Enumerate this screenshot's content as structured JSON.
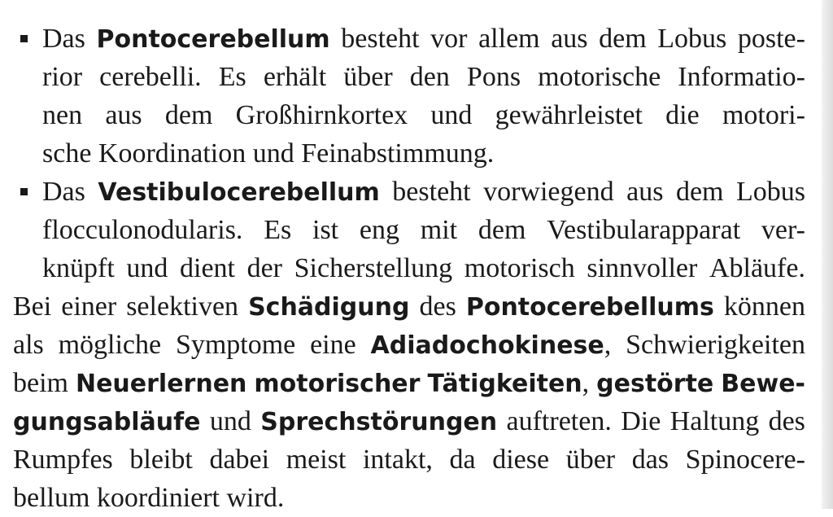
{
  "bullets": [
    {
      "lines": [
        [
          "Das",
          "Pontocerebellum",
          "besteht",
          "vor",
          "allem",
          "aus",
          "dem",
          "Lobus",
          "poste-"
        ],
        [
          "rior",
          "cerebelli.",
          "Es",
          "erhält",
          "über",
          "den",
          "Pons",
          "motorische",
          "Informatio-"
        ],
        [
          "nen",
          "aus",
          "dem",
          "Großhirnkortex",
          "und",
          "gewährleistet",
          "die",
          "motori-"
        ],
        [
          "sche Koordination und Feinabstimmung."
        ]
      ]
    },
    {
      "lines": [
        [
          "Das",
          "Vestibulocerebellum",
          "besteht",
          "vorwiegend",
          "aus",
          "dem",
          "Lobus"
        ],
        [
          "flocculonodularis.",
          "Es",
          "ist",
          "eng",
          "mit",
          "dem",
          "Vestibularapparat",
          "ver-"
        ],
        [
          "knüpft",
          "und",
          "dient",
          "der",
          "Sicherstellung",
          "motorisch",
          "sinnvoller",
          "Abläufe."
        ]
      ]
    }
  ],
  "paragraph": {
    "lines": [
      [
        "Bei",
        "einer",
        "selektiven",
        "Schädigung",
        "des",
        "Pontocerebellums",
        "können"
      ],
      [
        "als",
        "mögliche",
        "Symptome",
        "eine",
        "Adiadochokinese,",
        "Schwierigkeiten"
      ],
      [
        "beim",
        "Neuerlernen",
        "motorischer",
        "Tätigkeiten,",
        "gestörte",
        "Bewe-"
      ],
      [
        "gungsabläufe",
        "und",
        "Sprechstörungen",
        "auftreten.",
        "Die",
        "Haltung",
        "des"
      ],
      [
        "Rumpfes",
        "bleibt",
        "dabei",
        "meist",
        "intakt,",
        "da",
        "diese",
        "über",
        "das",
        "Spinocere-"
      ],
      [
        "bellum koordiniert wird."
      ]
    ]
  },
  "bold_terms": [
    "Pontocerebellum",
    "Vestibulocerebellum",
    "Schädigung",
    "Pontocerebellums",
    "Adiadochokinese",
    "Neuerlernen",
    "motorischer",
    "Tätigkeiten",
    "gestörte",
    "Bewe-",
    "gungsabläufe",
    "Sprechstörungen"
  ]
}
